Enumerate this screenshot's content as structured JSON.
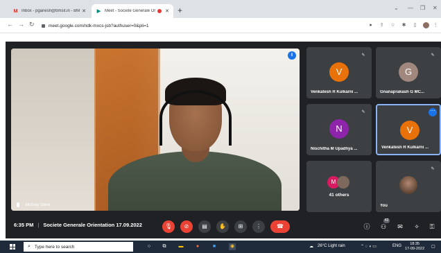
{
  "browser": {
    "tabs": [
      {
        "title": "Inbox - pganesh@bmsit.in - BM",
        "favicon": "gmail-icon"
      },
      {
        "title": "Meet - Societe Generale Or",
        "favicon": "meet-icon",
        "recording": true
      }
    ],
    "url": "meet.google.com/ndk-mxcs-jsb?authuser=0&pli=1"
  },
  "meeting": {
    "presenter_name": "akshay dave",
    "time": "6:35 PM",
    "title": "Societe Generale Orientation 17.09.2022",
    "people_badge": "42"
  },
  "tiles": [
    {
      "initial": "V",
      "name": "Venkatesh R Kulkarni ...",
      "color": "#e8710a"
    },
    {
      "initial": "G",
      "name": "Gnanaprakash G MC...",
      "color": "#a1887f"
    },
    {
      "initial": "N",
      "name": "Nischitha M Upadhya ...",
      "color": "#8e24aa"
    },
    {
      "initial": "V",
      "name": "Venkatesh R Kulkarni ...",
      "color": "#e8710a",
      "selected": true
    },
    {
      "initial": "M",
      "name": "41 others",
      "color": "#d81b60"
    },
    {
      "name": "You"
    }
  ],
  "taskbar": {
    "search_placeholder": "Type here to search",
    "weather": "26°C  Light rain",
    "lang": "ENG",
    "time": "18:35",
    "date": "17-09-2022"
  }
}
